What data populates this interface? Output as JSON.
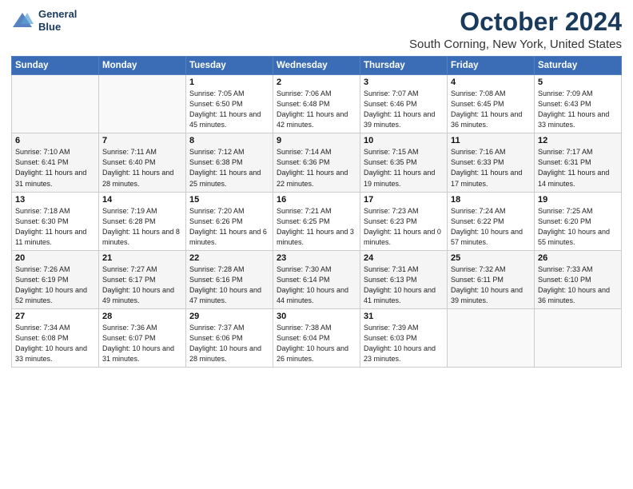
{
  "logo": {
    "line1": "General",
    "line2": "Blue"
  },
  "title": "October 2024",
  "location": "South Corning, New York, United States",
  "days_of_week": [
    "Sunday",
    "Monday",
    "Tuesday",
    "Wednesday",
    "Thursday",
    "Friday",
    "Saturday"
  ],
  "weeks": [
    [
      {
        "num": "",
        "sunrise": "",
        "sunset": "",
        "daylight": ""
      },
      {
        "num": "",
        "sunrise": "",
        "sunset": "",
        "daylight": ""
      },
      {
        "num": "1",
        "sunrise": "Sunrise: 7:05 AM",
        "sunset": "Sunset: 6:50 PM",
        "daylight": "Daylight: 11 hours and 45 minutes."
      },
      {
        "num": "2",
        "sunrise": "Sunrise: 7:06 AM",
        "sunset": "Sunset: 6:48 PM",
        "daylight": "Daylight: 11 hours and 42 minutes."
      },
      {
        "num": "3",
        "sunrise": "Sunrise: 7:07 AM",
        "sunset": "Sunset: 6:46 PM",
        "daylight": "Daylight: 11 hours and 39 minutes."
      },
      {
        "num": "4",
        "sunrise": "Sunrise: 7:08 AM",
        "sunset": "Sunset: 6:45 PM",
        "daylight": "Daylight: 11 hours and 36 minutes."
      },
      {
        "num": "5",
        "sunrise": "Sunrise: 7:09 AM",
        "sunset": "Sunset: 6:43 PM",
        "daylight": "Daylight: 11 hours and 33 minutes."
      }
    ],
    [
      {
        "num": "6",
        "sunrise": "Sunrise: 7:10 AM",
        "sunset": "Sunset: 6:41 PM",
        "daylight": "Daylight: 11 hours and 31 minutes."
      },
      {
        "num": "7",
        "sunrise": "Sunrise: 7:11 AM",
        "sunset": "Sunset: 6:40 PM",
        "daylight": "Daylight: 11 hours and 28 minutes."
      },
      {
        "num": "8",
        "sunrise": "Sunrise: 7:12 AM",
        "sunset": "Sunset: 6:38 PM",
        "daylight": "Daylight: 11 hours and 25 minutes."
      },
      {
        "num": "9",
        "sunrise": "Sunrise: 7:14 AM",
        "sunset": "Sunset: 6:36 PM",
        "daylight": "Daylight: 11 hours and 22 minutes."
      },
      {
        "num": "10",
        "sunrise": "Sunrise: 7:15 AM",
        "sunset": "Sunset: 6:35 PM",
        "daylight": "Daylight: 11 hours and 19 minutes."
      },
      {
        "num": "11",
        "sunrise": "Sunrise: 7:16 AM",
        "sunset": "Sunset: 6:33 PM",
        "daylight": "Daylight: 11 hours and 17 minutes."
      },
      {
        "num": "12",
        "sunrise": "Sunrise: 7:17 AM",
        "sunset": "Sunset: 6:31 PM",
        "daylight": "Daylight: 11 hours and 14 minutes."
      }
    ],
    [
      {
        "num": "13",
        "sunrise": "Sunrise: 7:18 AM",
        "sunset": "Sunset: 6:30 PM",
        "daylight": "Daylight: 11 hours and 11 minutes."
      },
      {
        "num": "14",
        "sunrise": "Sunrise: 7:19 AM",
        "sunset": "Sunset: 6:28 PM",
        "daylight": "Daylight: 11 hours and 8 minutes."
      },
      {
        "num": "15",
        "sunrise": "Sunrise: 7:20 AM",
        "sunset": "Sunset: 6:26 PM",
        "daylight": "Daylight: 11 hours and 6 minutes."
      },
      {
        "num": "16",
        "sunrise": "Sunrise: 7:21 AM",
        "sunset": "Sunset: 6:25 PM",
        "daylight": "Daylight: 11 hours and 3 minutes."
      },
      {
        "num": "17",
        "sunrise": "Sunrise: 7:23 AM",
        "sunset": "Sunset: 6:23 PM",
        "daylight": "Daylight: 11 hours and 0 minutes."
      },
      {
        "num": "18",
        "sunrise": "Sunrise: 7:24 AM",
        "sunset": "Sunset: 6:22 PM",
        "daylight": "Daylight: 10 hours and 57 minutes."
      },
      {
        "num": "19",
        "sunrise": "Sunrise: 7:25 AM",
        "sunset": "Sunset: 6:20 PM",
        "daylight": "Daylight: 10 hours and 55 minutes."
      }
    ],
    [
      {
        "num": "20",
        "sunrise": "Sunrise: 7:26 AM",
        "sunset": "Sunset: 6:19 PM",
        "daylight": "Daylight: 10 hours and 52 minutes."
      },
      {
        "num": "21",
        "sunrise": "Sunrise: 7:27 AM",
        "sunset": "Sunset: 6:17 PM",
        "daylight": "Daylight: 10 hours and 49 minutes."
      },
      {
        "num": "22",
        "sunrise": "Sunrise: 7:28 AM",
        "sunset": "Sunset: 6:16 PM",
        "daylight": "Daylight: 10 hours and 47 minutes."
      },
      {
        "num": "23",
        "sunrise": "Sunrise: 7:30 AM",
        "sunset": "Sunset: 6:14 PM",
        "daylight": "Daylight: 10 hours and 44 minutes."
      },
      {
        "num": "24",
        "sunrise": "Sunrise: 7:31 AM",
        "sunset": "Sunset: 6:13 PM",
        "daylight": "Daylight: 10 hours and 41 minutes."
      },
      {
        "num": "25",
        "sunrise": "Sunrise: 7:32 AM",
        "sunset": "Sunset: 6:11 PM",
        "daylight": "Daylight: 10 hours and 39 minutes."
      },
      {
        "num": "26",
        "sunrise": "Sunrise: 7:33 AM",
        "sunset": "Sunset: 6:10 PM",
        "daylight": "Daylight: 10 hours and 36 minutes."
      }
    ],
    [
      {
        "num": "27",
        "sunrise": "Sunrise: 7:34 AM",
        "sunset": "Sunset: 6:08 PM",
        "daylight": "Daylight: 10 hours and 33 minutes."
      },
      {
        "num": "28",
        "sunrise": "Sunrise: 7:36 AM",
        "sunset": "Sunset: 6:07 PM",
        "daylight": "Daylight: 10 hours and 31 minutes."
      },
      {
        "num": "29",
        "sunrise": "Sunrise: 7:37 AM",
        "sunset": "Sunset: 6:06 PM",
        "daylight": "Daylight: 10 hours and 28 minutes."
      },
      {
        "num": "30",
        "sunrise": "Sunrise: 7:38 AM",
        "sunset": "Sunset: 6:04 PM",
        "daylight": "Daylight: 10 hours and 26 minutes."
      },
      {
        "num": "31",
        "sunrise": "Sunrise: 7:39 AM",
        "sunset": "Sunset: 6:03 PM",
        "daylight": "Daylight: 10 hours and 23 minutes."
      },
      {
        "num": "",
        "sunrise": "",
        "sunset": "",
        "daylight": ""
      },
      {
        "num": "",
        "sunrise": "",
        "sunset": "",
        "daylight": ""
      }
    ]
  ]
}
